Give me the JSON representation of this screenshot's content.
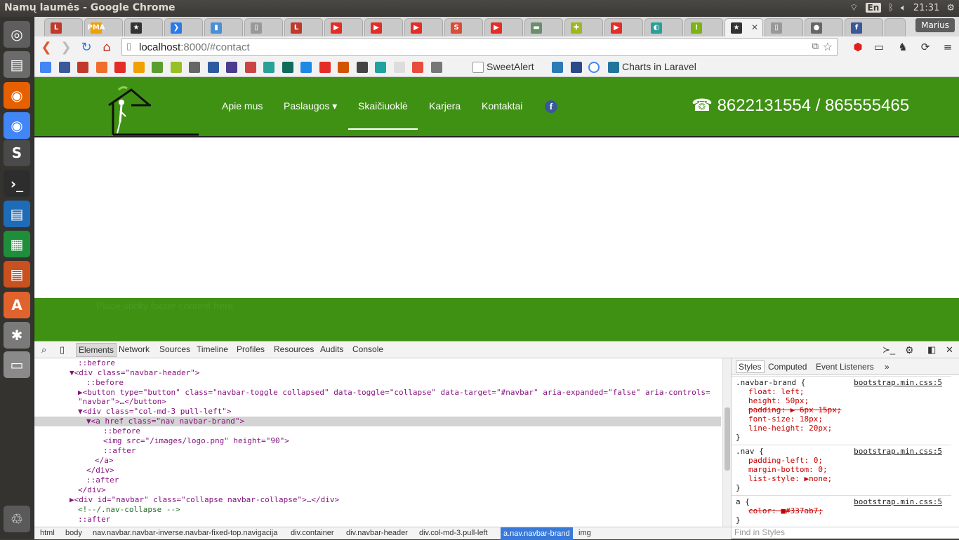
{
  "window": {
    "title": "Namų laumės - Google Chrome",
    "clock": "21:31",
    "keyboard_lang": "En",
    "user": "Marius"
  },
  "launcher": {
    "apps": [
      {
        "name": "dash",
        "glyph": "◎",
        "color": "#5e5e5e"
      },
      {
        "name": "files",
        "glyph": "▤",
        "color": "#6b6b6b"
      },
      {
        "name": "firefox",
        "glyph": "◉",
        "color": "#e66000"
      },
      {
        "name": "chrome",
        "glyph": "◉",
        "color": "#4285f4"
      },
      {
        "name": "sublime",
        "glyph": "S",
        "color": "#4a4a4a"
      },
      {
        "name": "terminal",
        "glyph": "›_",
        "color": "#2d2d2d"
      },
      {
        "name": "writer",
        "glyph": "▤",
        "color": "#1e6bb8"
      },
      {
        "name": "calc",
        "glyph": "▦",
        "color": "#1f8e3a"
      },
      {
        "name": "impress",
        "glyph": "▤",
        "color": "#c9511f"
      },
      {
        "name": "software",
        "glyph": "A",
        "color": "#e0632d"
      },
      {
        "name": "settings",
        "glyph": "✱",
        "color": "#7a7a7a"
      },
      {
        "name": "drive",
        "glyph": "▭",
        "color": "#8a8a8a"
      },
      {
        "name": "trash",
        "glyph": "♲",
        "color": "#5a5a5a"
      }
    ]
  },
  "tabs": [
    {
      "label": "L",
      "color": "#c0392b"
    },
    {
      "label": "PMA",
      "color": "#f0a000"
    },
    {
      "label": "★",
      "color": "#333333"
    },
    {
      "label": "❯",
      "color": "#2c7be5"
    },
    {
      "label": "▮",
      "color": "#4a90d9"
    },
    {
      "label": "▯",
      "color": "#999999"
    },
    {
      "label": "L",
      "color": "#c0392b"
    },
    {
      "label": "▶",
      "color": "#e52d27"
    },
    {
      "label": "▶",
      "color": "#e52d27"
    },
    {
      "label": "▶",
      "color": "#e52d27"
    },
    {
      "label": "S",
      "color": "#dd4b39"
    },
    {
      "label": "▶",
      "color": "#e52d27"
    },
    {
      "label": "▬",
      "color": "#6b8e6b"
    },
    {
      "label": "✚",
      "color": "#9cb91f"
    },
    {
      "label": "▶",
      "color": "#e52d27"
    },
    {
      "label": "◐",
      "color": "#2aa198"
    },
    {
      "label": "!",
      "color": "#7db313"
    },
    {
      "label": "★",
      "color": "#333333",
      "active": true
    },
    {
      "label": "▯",
      "color": "#999999"
    },
    {
      "label": "●",
      "color": "#666666"
    },
    {
      "label": "f",
      "color": "#3b5998"
    }
  ],
  "toolbar": {
    "url_host": "localhost",
    "url_rest": ":8000/#contact"
  },
  "bookmarks": {
    "icons": [
      "#4285f4",
      "#3b5998",
      "#c0392b",
      "#f06d2c",
      "#e52d27",
      "#f0a000",
      "#5a9e2e",
      "#97c024",
      "#666666",
      "#2c5aa0",
      "#4b3b8f",
      "#cc4444",
      "#2aa198",
      "#106b5b",
      "#1e88e5",
      "#e52d27",
      "#d35400",
      "#444444",
      "#20a39e",
      "#dddddd",
      "#e74c3c",
      "#777777"
    ],
    "sweetalert": "SweetAlert",
    "charts": "Charts in Laravel"
  },
  "site": {
    "menu": [
      {
        "label": "Apie mus"
      },
      {
        "label": "Paslaugos ▾"
      },
      {
        "label": "Skaičiuoklė",
        "active": true
      },
      {
        "label": "Karjera"
      },
      {
        "label": "Kontaktai"
      }
    ],
    "facebook_glyph": "f",
    "phone": "☎ 8622131554 / 865555465",
    "footer_text": "Place sticky footer content here."
  },
  "devtools": {
    "tabs": [
      "Elements",
      "Network",
      "Sources",
      "Timeline",
      "Profiles",
      "Resources",
      "Audits",
      "Console"
    ],
    "dom_lines": [
      "::before",
      "▼<div class=\"navbar-header\">",
      "::before",
      "▶<button type=\"button\" class=\"navbar-toggle collapsed\" data-toggle=\"collapse\" data-target=\"#navbar\" aria-expanded=\"false\" aria-controls=",
      "\"navbar\">…</button>",
      "▼<div class=\"col-md-3 pull-left\">",
      "▼<a href class=\"nav navbar-brand\">",
      "::before",
      "<img src=\"/images/logo.png\" height=\"90\">",
      "::after",
      "</a>",
      "</div>",
      "::after",
      "</div>",
      "▶<div id=\"navbar\" class=\"collapse navbar-collapse\">…</div>",
      "<!--/.nav-collapse -->",
      "::after"
    ],
    "styles_tabs": [
      "Styles",
      "Computed",
      "Event Listeners",
      "»"
    ],
    "rules": [
      {
        "selector": ".navbar-brand {",
        "source": "bootstrap.min.css:5",
        "props": [
          "float: left;",
          "height: 50px;",
          "padding: ▶ 6px 15px;",
          "font-size: 18px;",
          "line-height: 20px;"
        ]
      },
      {
        "selector": ".nav {",
        "source": "bootstrap.min.css:5",
        "props": [
          "padding-left: 0;",
          "margin-bottom: 0;",
          "list-style: ▶none;"
        ]
      },
      {
        "selector": "a {",
        "source": "bootstrap.min.css:5",
        "props": [
          "color: ■#337ab7;"
        ]
      }
    ],
    "find_placeholder": "Find in Styles",
    "breadcrumbs": [
      "html",
      "body",
      "nav.navbar.navbar-inverse.navbar-fixed-top.navigacija",
      "div.container",
      "div.navbar-header",
      "div.col-md-3.pull-left",
      "a.nav.navbar-brand",
      "img"
    ]
  }
}
